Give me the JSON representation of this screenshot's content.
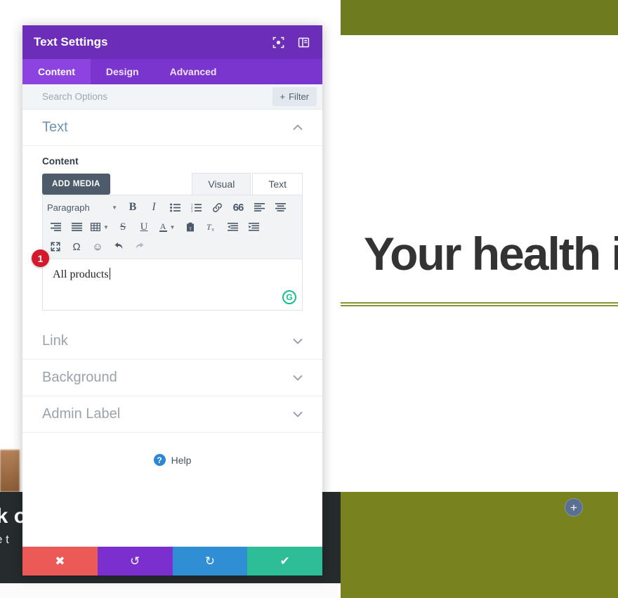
{
  "background_page": {
    "hero_heading": "Your health is",
    "dark_band_title": "ck o",
    "dark_band_subtitle": "ove t",
    "add_module_label": "+",
    "colors": {
      "olive": "#78821f",
      "olive_top": "#6e7b1f",
      "rule": "#8b9434",
      "dark_band": "#262b2d",
      "fab": "#5b6f93",
      "heading": "#333333"
    }
  },
  "modal": {
    "title": "Text Settings",
    "header_icons": [
      {
        "name": "focus-mode-icon",
        "label": "Focus Mode"
      },
      {
        "name": "panel-layout-icon",
        "label": "Change Layout"
      }
    ],
    "tabs": [
      {
        "label": "Content",
        "active": true
      },
      {
        "label": "Design",
        "active": false
      },
      {
        "label": "Advanced",
        "active": false
      }
    ],
    "search": {
      "placeholder": "Search Options",
      "value": ""
    },
    "filter_button": {
      "label": "Filter",
      "plus": "+"
    },
    "sections": [
      {
        "name": "text",
        "title": "Text",
        "open": true,
        "chevron": "up"
      },
      {
        "name": "link",
        "title": "Link",
        "open": false,
        "chevron": "down"
      },
      {
        "name": "background",
        "title": "Background",
        "open": false,
        "chevron": "down"
      },
      {
        "name": "admin-label",
        "title": "Admin Label",
        "open": false,
        "chevron": "down"
      }
    ],
    "text_section": {
      "field_label": "Content",
      "add_media_label": "ADD MEDIA",
      "editor_tabs": [
        {
          "label": "Visual",
          "active": true
        },
        {
          "label": "Text",
          "active": false
        }
      ],
      "format_select": {
        "value": "Paragraph"
      },
      "toolbar_rows": [
        [
          {
            "name": "bold-icon",
            "glyph": "B"
          },
          {
            "name": "italic-icon",
            "glyph": "I"
          },
          {
            "name": "bulleted-list-icon",
            "glyph": "list"
          },
          {
            "name": "numbered-list-icon",
            "glyph": "numlist"
          },
          {
            "name": "link-icon",
            "glyph": "link"
          },
          {
            "name": "blockquote-icon",
            "glyph": "quote"
          },
          {
            "name": "align-left-icon",
            "glyph": "alignleft"
          },
          {
            "name": "align-center-icon",
            "glyph": "aligncenter"
          }
        ],
        [
          {
            "name": "align-right-icon",
            "glyph": "alignright"
          },
          {
            "name": "align-justify-icon",
            "glyph": "alignjustify"
          },
          {
            "name": "table-icon",
            "glyph": "table"
          },
          {
            "name": "strikethrough-icon",
            "glyph": "S"
          },
          {
            "name": "underline-icon",
            "glyph": "U"
          },
          {
            "name": "text-color-icon",
            "glyph": "A"
          },
          {
            "name": "paste-as-text-icon",
            "glyph": "paste"
          },
          {
            "name": "clear-formatting-icon",
            "glyph": "clearfmt"
          },
          {
            "name": "outdent-icon",
            "glyph": "outdent"
          },
          {
            "name": "indent-icon",
            "glyph": "indent"
          }
        ],
        [
          {
            "name": "fullscreen-icon",
            "glyph": "fullscreen"
          },
          {
            "name": "special-character-icon",
            "glyph": "Ω"
          },
          {
            "name": "emoji-icon",
            "glyph": "☺"
          },
          {
            "name": "undo-icon",
            "glyph": "undo"
          },
          {
            "name": "redo-icon",
            "glyph": "redo",
            "disabled": true
          }
        ]
      ],
      "editor_value": "All products",
      "grammarly_icon": "G",
      "step_badge": "1"
    },
    "help": {
      "icon": "?",
      "label": "Help"
    },
    "footer_buttons": [
      {
        "name": "cancel-button",
        "icon": "✖",
        "color": "#eb5a56"
      },
      {
        "name": "undo-button",
        "icon": "↺",
        "color": "#7b2fcf"
      },
      {
        "name": "redo-button",
        "icon": "↻",
        "color": "#2f8ed4"
      },
      {
        "name": "save-button",
        "icon": "✔",
        "color": "#2dbd97"
      }
    ]
  }
}
